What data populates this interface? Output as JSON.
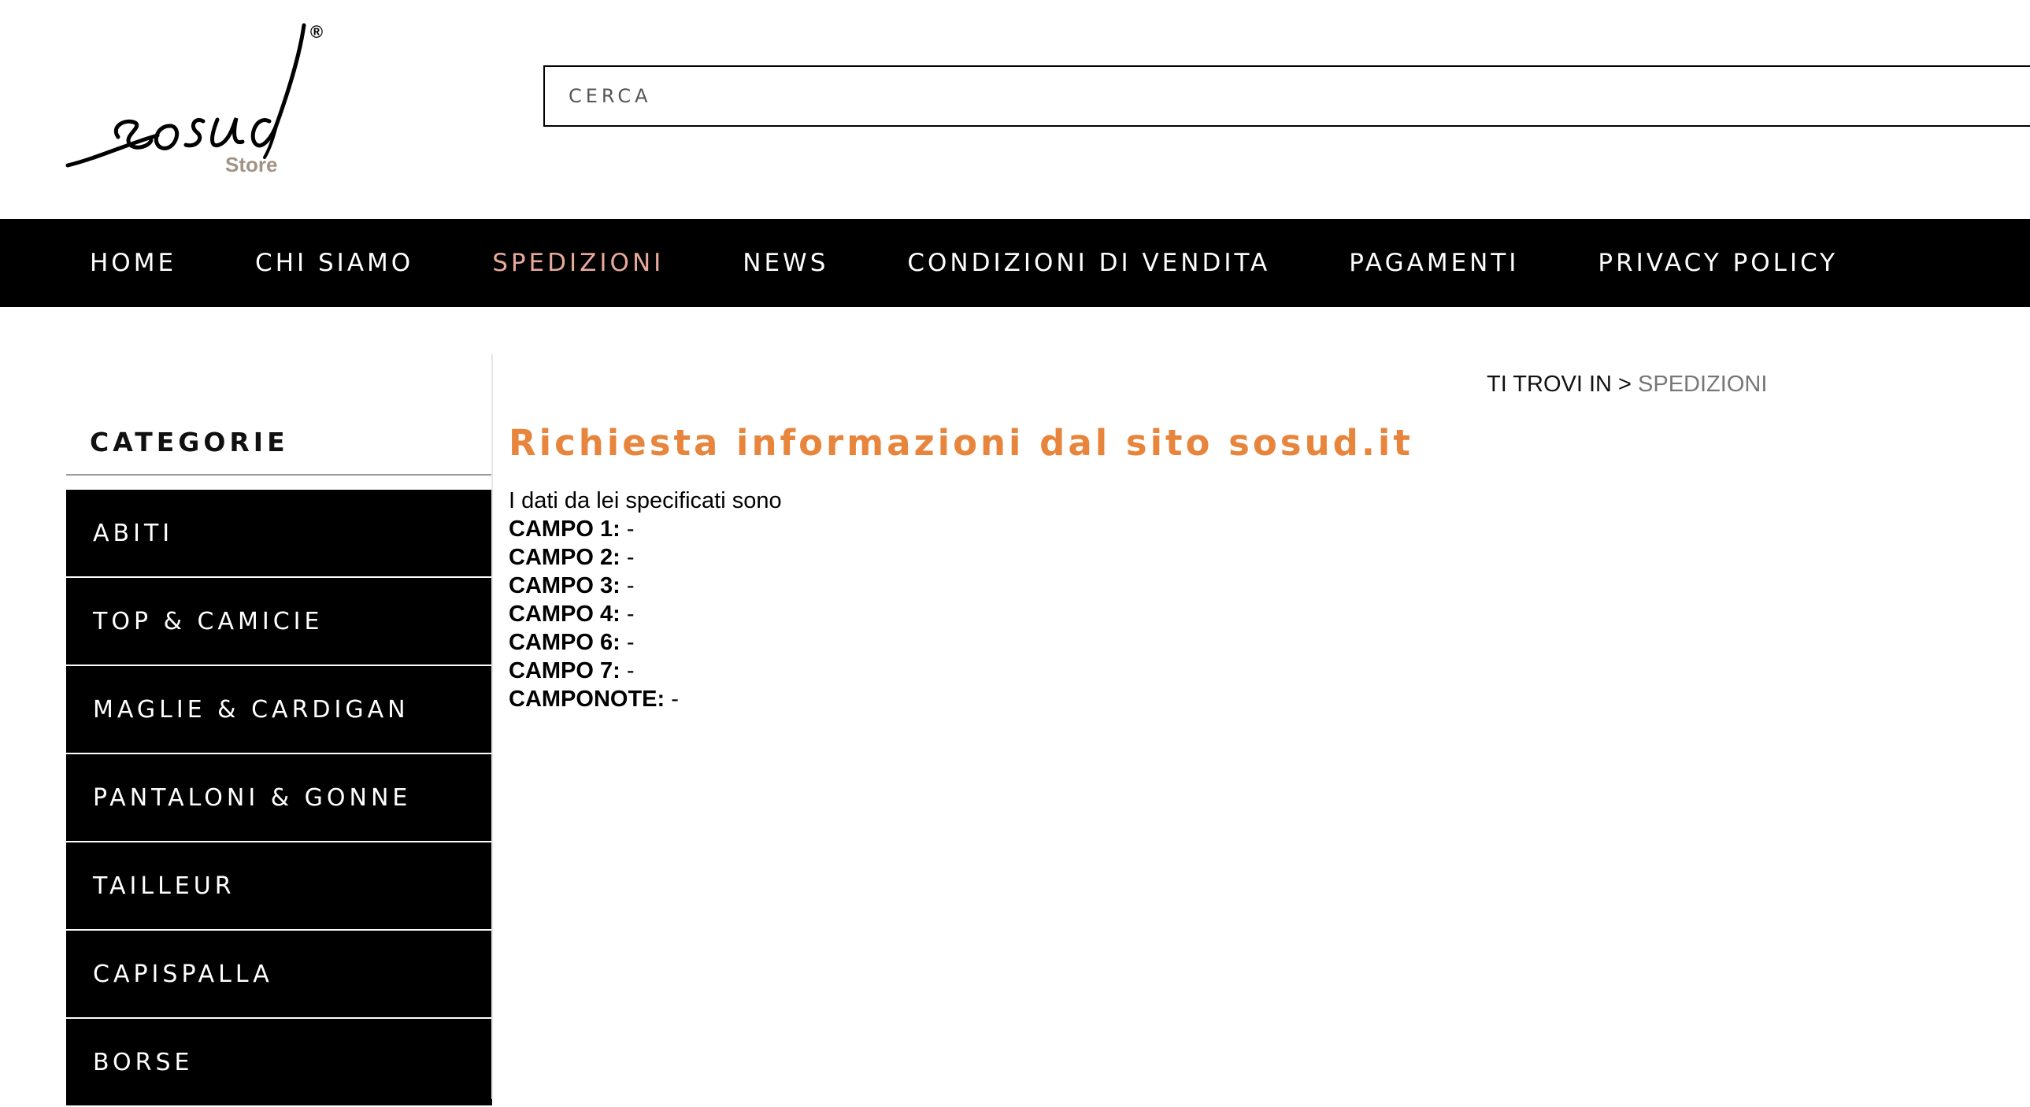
{
  "header": {
    "logo": {
      "brand": "sosud",
      "sub": "Store",
      "mark": "®",
      "sub_color": "#a39384"
    },
    "search": {
      "placeholder": "CERCA",
      "value": ""
    }
  },
  "nav": {
    "items": [
      {
        "label": "HOME",
        "active": false
      },
      {
        "label": "CHI SIAMO",
        "active": false
      },
      {
        "label": "SPEDIZIONI",
        "active": true
      },
      {
        "label": "NEWS",
        "active": false
      },
      {
        "label": "CONDIZIONI DI VENDITA",
        "active": false
      },
      {
        "label": "PAGAMENTI",
        "active": false
      },
      {
        "label": "PRIVACY POLICY",
        "active": false
      }
    ],
    "active_color": "#e8a99a"
  },
  "sidebar": {
    "title": "CATEGORIE",
    "items": [
      {
        "label": "ABITI"
      },
      {
        "label": "TOP & CAMICIE"
      },
      {
        "label": "MAGLIE & CARDIGAN"
      },
      {
        "label": "PANTALONI & GONNE"
      },
      {
        "label": "TAILLEUR"
      },
      {
        "label": "CAPISPALLA"
      },
      {
        "label": "BORSE"
      }
    ]
  },
  "breadcrumb": {
    "prefix": "TI TROVI IN >",
    "current": "SPEDIZIONI"
  },
  "main": {
    "title": "Richiesta informazioni dal sito sosud.it",
    "title_color": "#e8853d",
    "intro": "I dati da lei specificati sono",
    "fields": [
      {
        "label": "CAMPO 1:",
        "value": "-"
      },
      {
        "label": "CAMPO 2:",
        "value": "-"
      },
      {
        "label": "CAMPO 3:",
        "value": "-"
      },
      {
        "label": "CAMPO 4:",
        "value": "-"
      },
      {
        "label": "CAMPO 6:",
        "value": "-"
      },
      {
        "label": "CAMPO 7:",
        "value": "-"
      },
      {
        "label": "CAMPONOTE:",
        "value": "-"
      }
    ]
  }
}
